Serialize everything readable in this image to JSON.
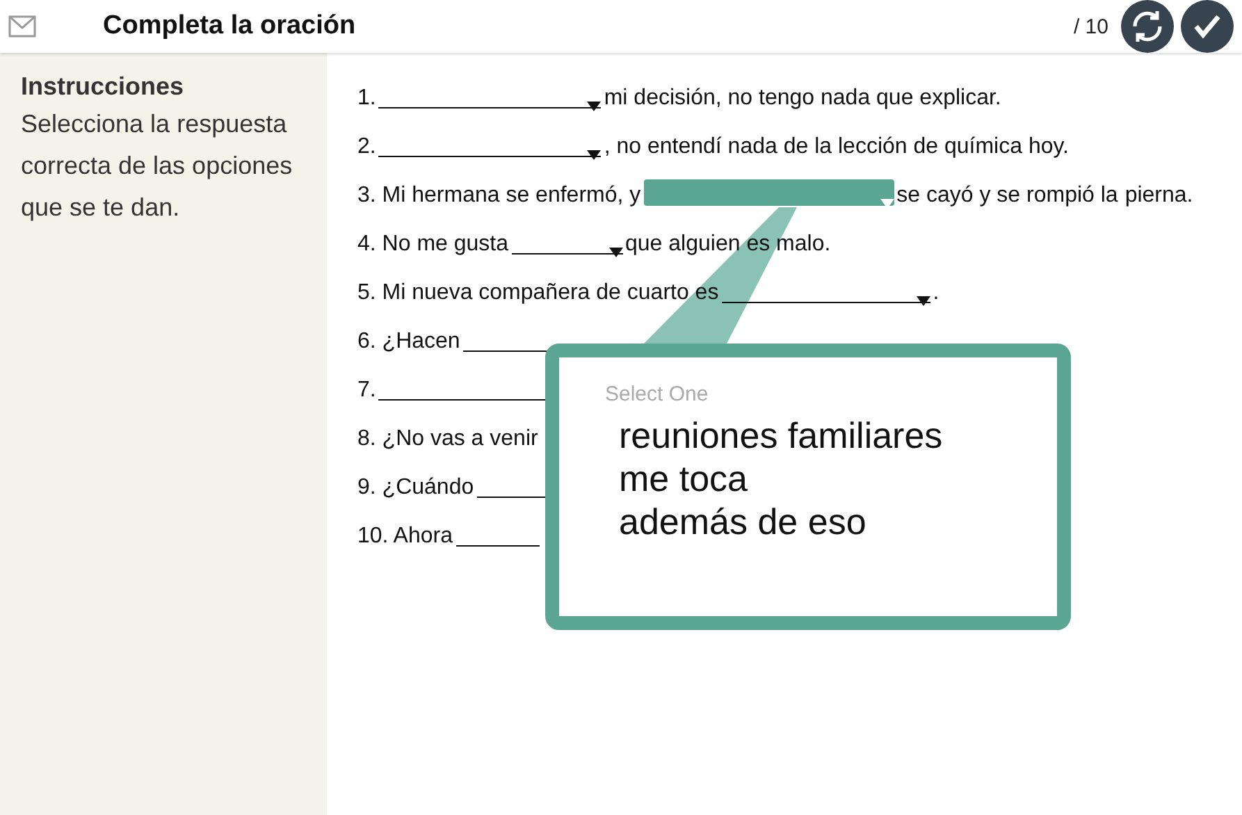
{
  "header": {
    "title": "Completa la oración",
    "score": "/ 10"
  },
  "instructions": {
    "title": "Instrucciones",
    "text": "Selecciona la respuesta correcta de las opciones que se te dan."
  },
  "questions": [
    {
      "parts": [
        {
          "kind": "text",
          "text": "1."
        },
        {
          "kind": "blank",
          "selected": false,
          "arrow": true
        },
        {
          "kind": "text",
          "text": "mi decisión, no tengo nada que explicar."
        }
      ]
    },
    {
      "parts": [
        {
          "kind": "text",
          "text": "2."
        },
        {
          "kind": "blank",
          "selected": false,
          "arrow": true
        },
        {
          "kind": "text",
          "text": ", no entendí nada de la lección de química hoy."
        }
      ]
    },
    {
      "parts": [
        {
          "kind": "text",
          "text": "3. Mi hermana se enfermó, y"
        },
        {
          "kind": "blank",
          "selected": true,
          "arrow": true
        },
        {
          "kind": "text",
          "text": "se cayó y se rompió la"
        },
        {
          "kind": "text",
          "text": "pierna."
        }
      ]
    },
    {
      "parts": [
        {
          "kind": "text",
          "text": "4. No me gusta"
        },
        {
          "kind": "blank",
          "selected": false,
          "arrow": true
        },
        {
          "kind": "text",
          "text": "que alguien es malo."
        }
      ]
    },
    {
      "parts": [
        {
          "kind": "text",
          "text": "5. Mi nueva compañera de cuarto es"
        },
        {
          "kind": "blank",
          "selected": false,
          "arrow": true
        },
        {
          "kind": "text",
          "text": "."
        }
      ]
    },
    {
      "parts": [
        {
          "kind": "text",
          "text": "6. ¿Hacen"
        },
        {
          "kind": "blank",
          "selected": false
        }
      ]
    },
    {
      "parts": [
        {
          "kind": "text",
          "text": "7."
        },
        {
          "kind": "blank",
          "selected": false
        }
      ]
    },
    {
      "parts": [
        {
          "kind": "text",
          "text": "8. ¿No vas a venir"
        }
      ]
    },
    {
      "parts": [
        {
          "kind": "text",
          "text": "9. ¿Cuándo"
        },
        {
          "kind": "blank",
          "selected": false
        }
      ]
    },
    {
      "parts": [
        {
          "kind": "text",
          "text": "10. Ahora"
        },
        {
          "kind": "blank",
          "selected": false
        }
      ]
    }
  ],
  "popup": {
    "placeholder": "Select One",
    "options": [
      "reuniones familiares",
      "me toca",
      "además de eso"
    ]
  }
}
